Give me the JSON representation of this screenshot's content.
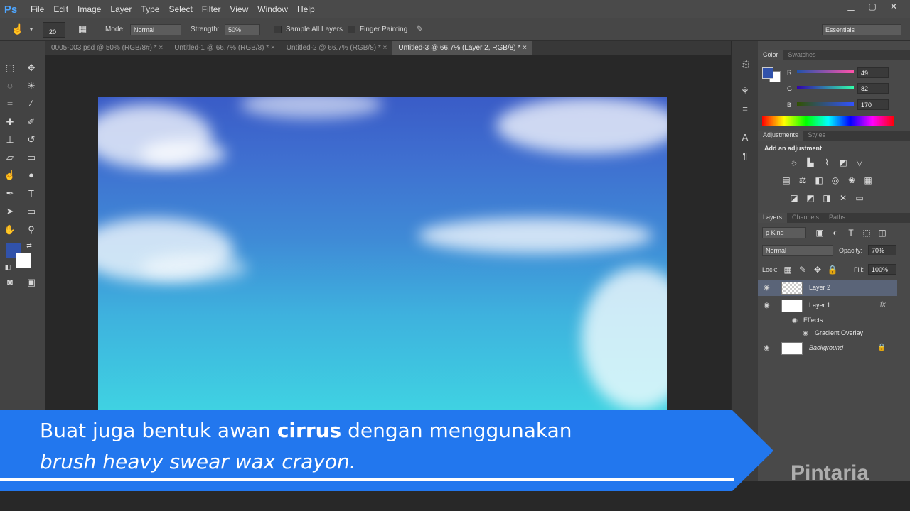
{
  "app": {
    "logo": "Ps"
  },
  "menu": [
    "File",
    "Edit",
    "Image",
    "Layer",
    "Type",
    "Select",
    "Filter",
    "View",
    "Window",
    "Help"
  ],
  "window_controls": [
    "▁",
    "▢",
    "✕"
  ],
  "options_bar": {
    "brush_size": "20",
    "mode_label": "Mode:",
    "mode_value": "Normal",
    "strength_label": "Strength:",
    "strength_value": "50%",
    "sample_all_layers": "Sample All Layers",
    "finger_painting": "Finger Painting",
    "workspace": "Essentials"
  },
  "tabs": [
    {
      "label": "0005-003.psd @ 50% (RGB/8#) *  ×"
    },
    {
      "label": "Untitled-1 @ 66.7% (RGB/8) *  ×"
    },
    {
      "label": "Untitled-2 @ 66.7% (RGB/8) *  ×"
    },
    {
      "label": "Untitled-3 @ 66.7% (Layer 2, RGB/8) *  ×"
    }
  ],
  "color_panel": {
    "tabs": [
      "Color",
      "Swatches"
    ],
    "r_label": "R",
    "r_value": "49",
    "g_label": "G",
    "g_value": "82",
    "b_label": "B",
    "b_value": "170",
    "fg_color": "#3152aa",
    "bg_color": "#ffffff"
  },
  "adjustments_panel": {
    "tabs": [
      "Adjustments",
      "Styles"
    ],
    "heading": "Add an adjustment"
  },
  "layers_panel": {
    "tabs": [
      "Layers",
      "Channels",
      "Paths"
    ],
    "kind": "ρ Kind",
    "blend_mode": "Normal",
    "opacity_label": "Opacity:",
    "opacity_value": "70%",
    "lock_label": "Lock:",
    "fill_label": "Fill:",
    "fill_value": "100%",
    "layers": [
      {
        "name": "Layer 2"
      },
      {
        "name": "Layer 1"
      },
      {
        "name": "Effects"
      },
      {
        "name": "Gradient Overlay"
      },
      {
        "name": "Background"
      }
    ],
    "fx": "fx"
  },
  "caption": {
    "line1_pre": "Buat juga bentuk awan ",
    "line1_bold": "cirrus",
    "line1_post": " dengan menggunakan",
    "line2": "brush  heavy swear wax crayon."
  },
  "watermark": "Pintaria"
}
